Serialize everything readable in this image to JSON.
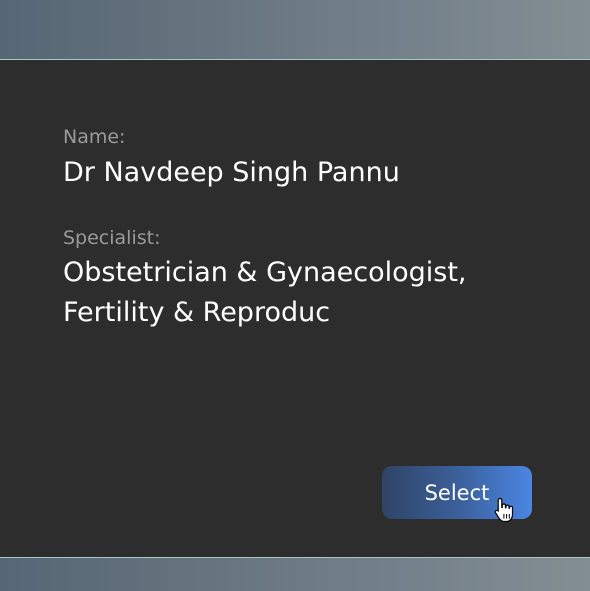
{
  "doctor": {
    "name_label": "Name:",
    "name": "Dr Navdeep Singh Pannu",
    "specialist_label": "Specialist:",
    "specialist_line1": "Obstetrician & Gynaecologist,",
    "specialist_line2": "Fertility & Reproduc"
  },
  "actions": {
    "select_label": "Select"
  },
  "colors": {
    "card_background": "#2d2d2d",
    "button_gradient_start": "#2f4466",
    "button_gradient_end": "#4a86e3"
  },
  "icons": {
    "cursor": "hand-pointer-icon"
  }
}
